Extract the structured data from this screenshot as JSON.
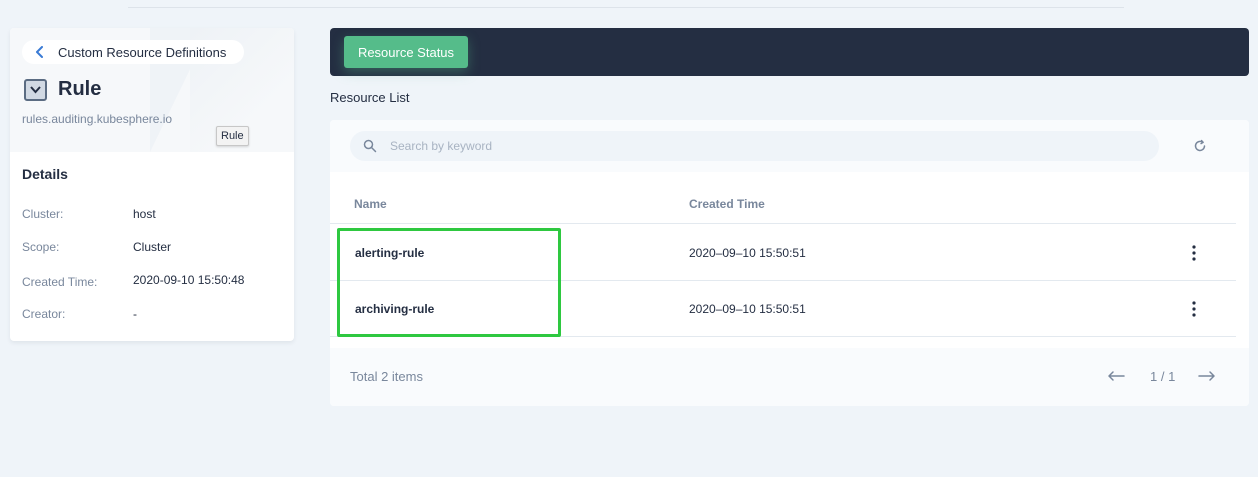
{
  "sidebar": {
    "back_label": "Custom Resource Definitions",
    "title": "Rule",
    "subtitle": "rules.auditing.kubesphere.io",
    "tooltip": "Rule",
    "details_title": "Details",
    "details": [
      {
        "key": "Cluster:",
        "value": "host"
      },
      {
        "key": "Scope:",
        "value": "Cluster"
      },
      {
        "key": "Created Time:",
        "value": "2020-09-10 15:50:48"
      },
      {
        "key": "Creator:",
        "value": "-"
      }
    ]
  },
  "banner": {
    "status_button": "Resource Status"
  },
  "resource_list": {
    "title": "Resource List",
    "search_placeholder": "Search by keyword",
    "columns": [
      "Name",
      "Created Time"
    ],
    "rows": [
      {
        "name": "alerting-rule",
        "created": "2020–09–10 15:50:51"
      },
      {
        "name": "archiving-rule",
        "created": "2020–09–10 15:50:51"
      }
    ],
    "total": "Total 2 items",
    "pagination": "1 / 1"
  },
  "colors": {
    "accent": "#55bc8a",
    "dark": "#242e42",
    "highlight": "#2ec840",
    "background": "#eff4f9"
  },
  "icons": [
    "chevron-left-icon",
    "crd-icon",
    "search-icon",
    "refresh-icon",
    "more-icon",
    "arrow-left-icon",
    "arrow-right-icon"
  ]
}
